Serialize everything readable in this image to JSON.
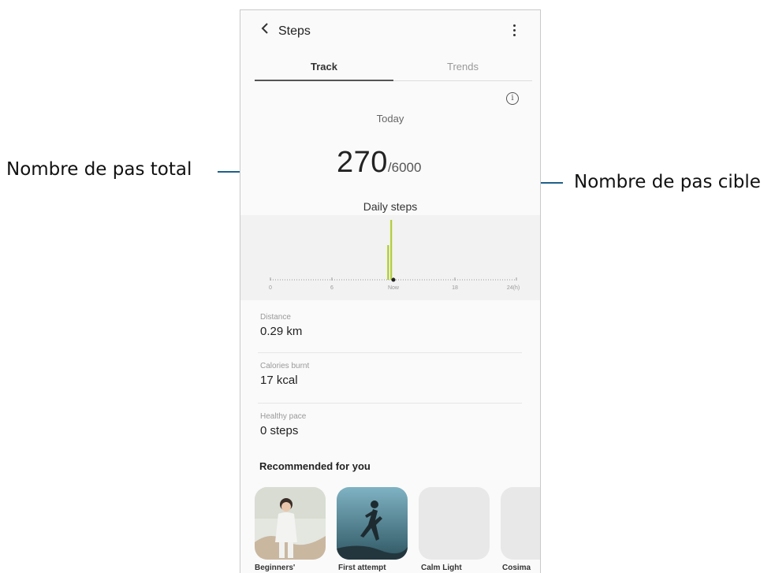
{
  "callouts": {
    "left": "Nombre de pas total",
    "right": "Nombre de pas cible"
  },
  "appbar": {
    "back_icon": "chevron-left-icon",
    "title": "Steps",
    "more_icon": "more-vertical-icon"
  },
  "tabs": [
    {
      "label": "Track",
      "selected": true
    },
    {
      "label": "Trends",
      "selected": false
    }
  ],
  "summary": {
    "info_icon": "info-icon",
    "period": "Today",
    "steps": "270",
    "goal": "/6000",
    "chart_title": "Daily steps"
  },
  "chart_data": {
    "type": "bar",
    "x_ticks": [
      "0",
      "6",
      "Now",
      "18",
      "24(h)"
    ],
    "xlim": [
      0,
      24
    ],
    "bars": [
      {
        "hour": 11.5,
        "value": 0.55
      },
      {
        "hour": 11.8,
        "value": 0.95
      }
    ],
    "now_hour": 12,
    "colors": {
      "bar": "#c6e24a",
      "bar_line": "#8a9a3a",
      "axis": "#9a9a9a"
    }
  },
  "metrics": [
    {
      "label": "Distance",
      "value": "0.29 km"
    },
    {
      "label": "Calories burnt",
      "value": "17 kcal"
    },
    {
      "label": "Healthy pace",
      "value": "0 steps"
    }
  ],
  "recommended": {
    "title": "Recommended for you",
    "items": [
      {
        "label": "Beginners'",
        "image": "woman-fitness-photo"
      },
      {
        "label": "First attempt",
        "image": "runner-silhouette-photo"
      },
      {
        "label": "Calm Light",
        "image": "placeholder"
      },
      {
        "label": "Cosima",
        "image": "placeholder"
      }
    ]
  },
  "colors": {
    "accent_line": "#1f5f8b",
    "chart_bg": "#f2f2f2",
    "card_placeholder": "#e8e8e8"
  }
}
